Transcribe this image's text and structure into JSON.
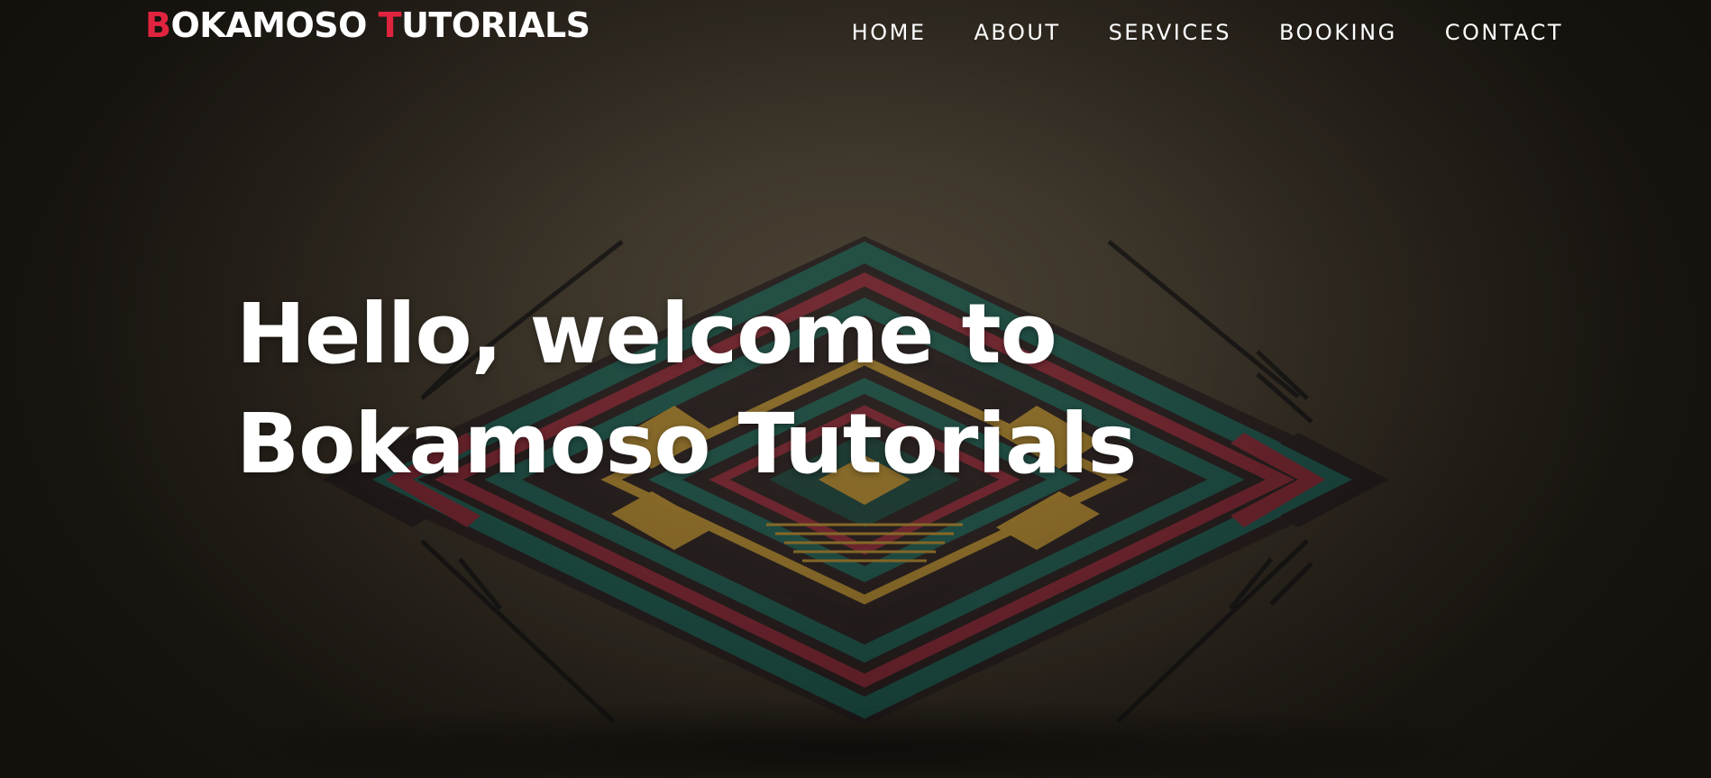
{
  "brand": {
    "first_initial": "B",
    "first_rest": "OKAMOSO",
    "second_initial": "T",
    "second_rest": "UTORIALS"
  },
  "nav": {
    "items": [
      {
        "label": "HOME"
      },
      {
        "label": "ABOUT"
      },
      {
        "label": "SERVICES"
      },
      {
        "label": "BOOKING"
      },
      {
        "label": "CONTACT"
      }
    ]
  },
  "hero": {
    "line1": "Hello, welcome to",
    "line2": "Bokamoso Tutorials"
  },
  "colors": {
    "accent": "#e0243f",
    "text": "#ffffff",
    "background": "#2a251d",
    "art_teal": "#0f5a52",
    "art_red": "#8c1f33",
    "art_gold": "#b58a2a",
    "art_dark": "#1a1418"
  }
}
